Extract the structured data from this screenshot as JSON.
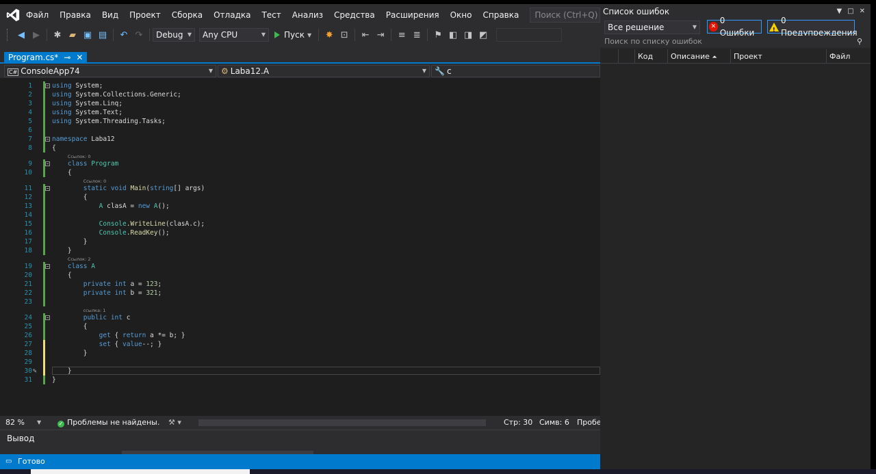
{
  "menu": {
    "items": [
      "Файл",
      "Правка",
      "Вид",
      "Проект",
      "Сборка",
      "Отладка",
      "Тест",
      "Анализ",
      "Средства",
      "Расширения",
      "Окно",
      "Справка"
    ],
    "search_placeholder": "Поиск (Ctrl+Q)"
  },
  "toolbar": {
    "config": "Debug",
    "platform": "Any CPU",
    "run_label": "Пуск"
  },
  "tab": {
    "label": "Program.cs*",
    "pin": "⊸",
    "close": "✕"
  },
  "navbar": {
    "project": "ConsoleApp74",
    "type": "Laba12.A",
    "member": "c"
  },
  "code_lines": [
    {
      "n": "1",
      "html": "<span class=\"kw\">using</span> System;"
    },
    {
      "n": "2",
      "html": "<span class=\"kw\">using</span> System.Collections.Generic;"
    },
    {
      "n": "3",
      "html": "<span class=\"kw\">using</span> System.Linq;"
    },
    {
      "n": "4",
      "html": "<span class=\"kw\">using</span> System.Text;"
    },
    {
      "n": "5",
      "html": "<span class=\"kw\">using</span> System.Threading.Tasks;"
    },
    {
      "n": "6",
      "html": ""
    },
    {
      "n": "7",
      "html": "<span class=\"kw\">namespace</span> Laba12"
    },
    {
      "n": "8",
      "html": "{"
    },
    {
      "n": "9",
      "html": "    <span class=\"kw\">class</span> <span class=\"ty\">Program</span>"
    },
    {
      "n": "10",
      "html": "    {"
    },
    {
      "n": "11",
      "html": "        <span class=\"kw\">static</span> <span class=\"kw\">void</span> <span class=\"fn\">Main</span>(<span class=\"kw\">string</span>[] args)"
    },
    {
      "n": "12",
      "html": "        {"
    },
    {
      "n": "13",
      "html": "            <span class=\"ty\">A</span> clasA = <span class=\"kw\">new</span> <span class=\"ty\">A</span>();"
    },
    {
      "n": "14",
      "html": ""
    },
    {
      "n": "15",
      "html": "            <span class=\"ty\">Console</span>.<span class=\"fn\">WriteLine</span>(clasA.c);"
    },
    {
      "n": "16",
      "html": "            <span class=\"ty\">Console</span>.<span class=\"fn\">ReadKey</span>();"
    },
    {
      "n": "17",
      "html": "        }"
    },
    {
      "n": "18",
      "html": "    }"
    },
    {
      "n": "19",
      "html": "    <span class=\"kw\">class</span> <span class=\"ty\">A</span>"
    },
    {
      "n": "20",
      "html": "    {"
    },
    {
      "n": "21",
      "html": "        <span class=\"kw\">private</span> <span class=\"kw\">int</span> a = <span class=\"num\">123</span>;"
    },
    {
      "n": "22",
      "html": "        <span class=\"kw\">private</span> <span class=\"kw\">int</span> b = <span class=\"num\">321</span>;"
    },
    {
      "n": "23",
      "html": ""
    },
    {
      "n": "24",
      "html": "        <span class=\"kw\">public</span> <span class=\"kw\">int</span> c"
    },
    {
      "n": "25",
      "html": "        {"
    },
    {
      "n": "26",
      "html": "            <span class=\"kw\">get</span> { <span class=\"kw\">return</span> a *= b; }"
    },
    {
      "n": "27",
      "html": "            <span class=\"kw\">set</span> { <span class=\"kw\">value</span>--; }"
    },
    {
      "n": "28",
      "html": "        }"
    },
    {
      "n": "29",
      "html": ""
    },
    {
      "n": "30",
      "html": "    }"
    },
    {
      "n": "31",
      "html": "}"
    }
  ],
  "lens": [
    {
      "before": "9",
      "text": "Ссылок: 0"
    },
    {
      "before": "11",
      "text": "Ссылок: 0"
    },
    {
      "before": "19",
      "text": "Ссылок: 2"
    },
    {
      "before": "24",
      "text": "ссылка: 1"
    }
  ],
  "status": {
    "zoom": "82 %",
    "problems": "Проблемы не найдены.",
    "line": "Стр: 30",
    "col": "Симв: 6",
    "extra": "Пробе"
  },
  "output_title": "Вывод",
  "ready": "Готово",
  "errlist": {
    "title": "Список ошибок",
    "scope": "Все решение",
    "errors": "0 Ошибки",
    "warnings": "0 Предупреждения",
    "search_placeholder": "Поиск по списку ошибок",
    "columns": [
      "Код",
      "Описание",
      "Проект",
      "Файл"
    ]
  },
  "colors": {
    "accent": "#007acc",
    "ok": "#3fb950",
    "error": "#e51400",
    "warning": "#f8d000"
  }
}
